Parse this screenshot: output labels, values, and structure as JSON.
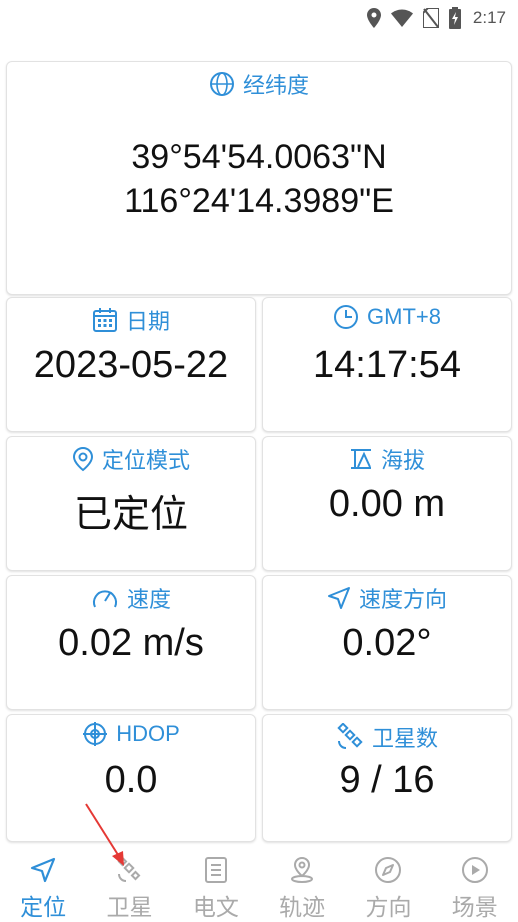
{
  "status_bar": {
    "time": "2:17"
  },
  "coordinates": {
    "title": "经纬度",
    "latitude": "39°54'54.0063\"N",
    "longitude": "116°24'14.3989\"E"
  },
  "cards": {
    "date": {
      "label": "日期",
      "value": "2023-05-22"
    },
    "time": {
      "label": "GMT+8",
      "value": "14:17:54"
    },
    "mode": {
      "label": "定位模式",
      "value": "已定位"
    },
    "altitude": {
      "label": "海拔",
      "value": "0.00 m"
    },
    "speed": {
      "label": "速度",
      "value": "0.02 m/s"
    },
    "heading": {
      "label": "速度方向",
      "value": "0.02°"
    },
    "hdop": {
      "label": "HDOP",
      "value": "0.0"
    },
    "satellites": {
      "label": "卫星数",
      "value": "9 / 16"
    }
  },
  "nav": {
    "items": [
      {
        "label": "定位",
        "icon": "navigation-arrow-icon",
        "active": true
      },
      {
        "label": "卫星",
        "icon": "satellite-icon",
        "active": false
      },
      {
        "label": "电文",
        "icon": "document-icon",
        "active": false
      },
      {
        "label": "轨迹",
        "icon": "map-pin-track-icon",
        "active": false
      },
      {
        "label": "方向",
        "icon": "compass-icon",
        "active": false
      },
      {
        "label": "场景",
        "icon": "play-circle-icon",
        "active": false
      }
    ]
  },
  "colors": {
    "accent": "#2f8fd8",
    "inactive": "#aaaaaa",
    "annotation": "#e53935"
  }
}
